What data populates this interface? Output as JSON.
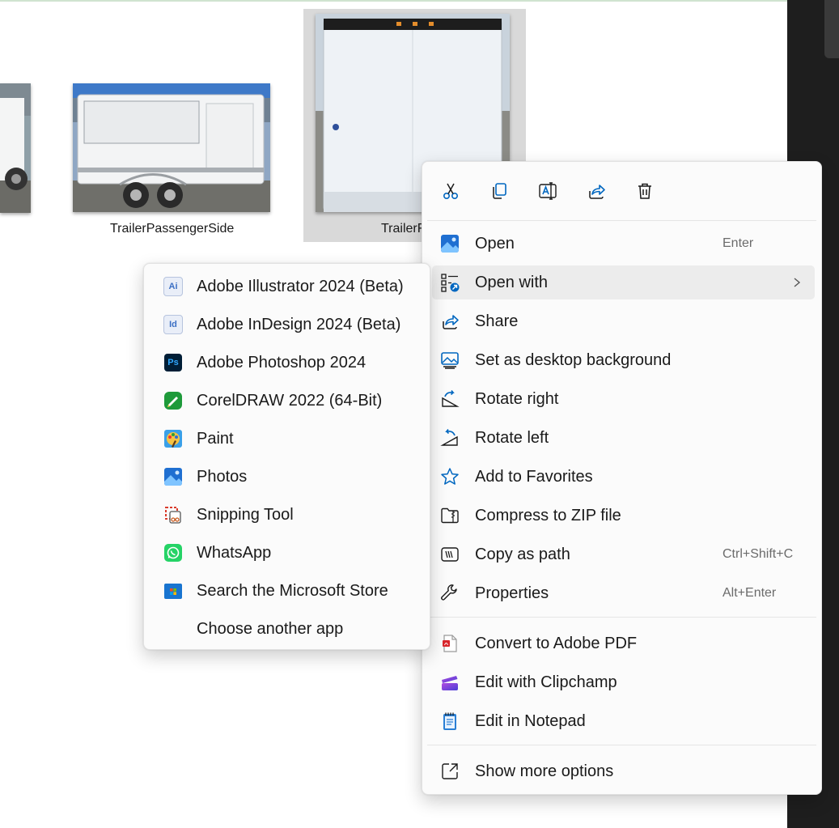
{
  "thumbnails": [
    {
      "label": ""
    },
    {
      "label": "TrailerPassengerSide"
    },
    {
      "label": "TrailerF"
    }
  ],
  "toolbar": {
    "cut_icon": "cut-icon",
    "copy_icon": "copy-icon",
    "rename_icon": "rename-icon",
    "share_icon": "share-icon",
    "delete_icon": "delete-icon"
  },
  "context_menu": {
    "items": [
      {
        "label": "Open",
        "shortcut": "Enter"
      },
      {
        "label": "Open with"
      },
      {
        "label": "Share"
      },
      {
        "label": "Set as desktop background"
      },
      {
        "label": "Rotate right"
      },
      {
        "label": "Rotate left"
      },
      {
        "label": "Add to Favorites"
      },
      {
        "label": "Compress to ZIP file"
      },
      {
        "label": "Copy as path",
        "shortcut": "Ctrl+Shift+C"
      },
      {
        "label": "Properties",
        "shortcut": "Alt+Enter"
      },
      {
        "label": "Convert to Adobe PDF"
      },
      {
        "label": "Edit with Clipchamp"
      },
      {
        "label": "Edit in Notepad"
      },
      {
        "label": "Show more options"
      }
    ]
  },
  "open_with_submenu": {
    "items": [
      {
        "label": "Adobe Illustrator 2024 (Beta)",
        "badge": "Ai"
      },
      {
        "label": "Adobe InDesign 2024 (Beta)",
        "badge": "Id"
      },
      {
        "label": "Adobe Photoshop 2024",
        "badge": "Ps"
      },
      {
        "label": "CorelDRAW 2022 (64-Bit)"
      },
      {
        "label": "Paint"
      },
      {
        "label": "Photos"
      },
      {
        "label": "Snipping Tool"
      },
      {
        "label": "WhatsApp"
      },
      {
        "label": "Search the Microsoft Store"
      },
      {
        "label": "Choose another app"
      }
    ]
  },
  "colors": {
    "accent": "#0067c0",
    "menu_bg": "#fbfbfb",
    "hover_bg": "#ececec",
    "selection_bg": "#d9d9d9"
  }
}
